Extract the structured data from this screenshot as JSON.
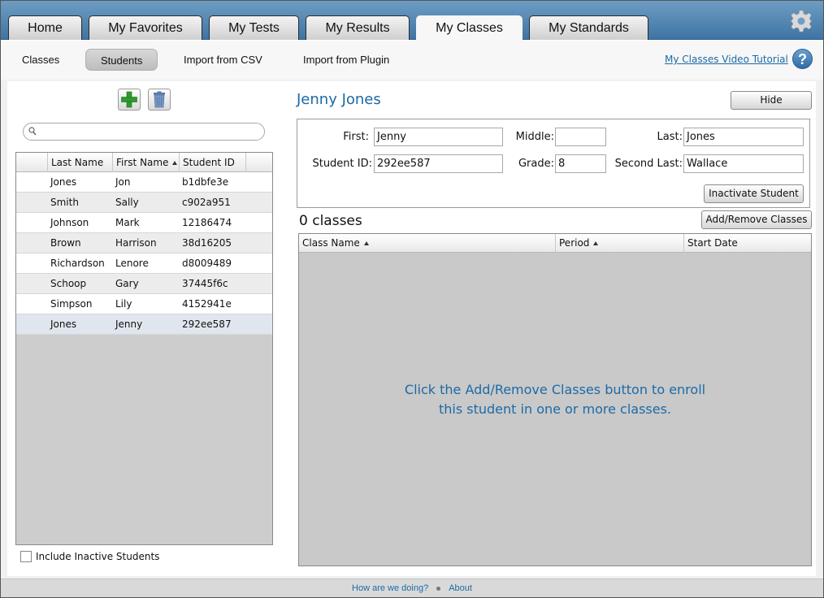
{
  "tabs": [
    {
      "label": "Home",
      "active": false
    },
    {
      "label": "My Favorites",
      "active": false
    },
    {
      "label": "My Tests",
      "active": false
    },
    {
      "label": "My Results",
      "active": false
    },
    {
      "label": "My Classes",
      "active": true
    },
    {
      "label": "My Standards",
      "active": false
    }
  ],
  "subnav": {
    "items": [
      {
        "label": "Classes",
        "active": false
      },
      {
        "label": "Students",
        "active": true
      },
      {
        "label": "Import from CSV",
        "active": false
      },
      {
        "label": "Import from Plugin",
        "active": false
      }
    ],
    "tutorial_link": "My Classes Video Tutorial",
    "help_label": "?"
  },
  "student_list": {
    "search_placeholder": "",
    "columns": [
      "Last Name",
      "First Name",
      "Student ID"
    ],
    "rows": [
      {
        "last": "Jones",
        "first": "Jon",
        "id": "b1dbfe3e"
      },
      {
        "last": "Smith",
        "first": "Sally",
        "id": "c902a951"
      },
      {
        "last": "Johnson",
        "first": "Mark",
        "id": "12186474"
      },
      {
        "last": "Brown",
        "first": "Harrison",
        "id": "38d16205"
      },
      {
        "last": "Richardson",
        "first": "Lenore",
        "id": "d8009489"
      },
      {
        "last": "Schoop",
        "first": "Gary",
        "id": "37445f6c"
      },
      {
        "last": "Simpson",
        "first": "Lily",
        "id": "4152941e"
      },
      {
        "last": "Jones",
        "first": "Jenny",
        "id": "292ee587"
      }
    ],
    "selected_index": 7,
    "include_inactive_label": "Include Inactive Students",
    "include_inactive_checked": false
  },
  "student_detail": {
    "name": "Jenny Jones",
    "hide_label": "Hide",
    "fields": {
      "first_label": "First:",
      "first_value": "Jenny",
      "middle_label": "Middle:",
      "middle_value": "",
      "last_label": "Last:",
      "last_value": "Jones",
      "student_id_label": "Student ID:",
      "student_id_value": "292ee587",
      "grade_label": "Grade:",
      "grade_value": "8",
      "second_last_label": "Second Last:",
      "second_last_value": "Wallace"
    },
    "inactivate_label": "Inactivate Student"
  },
  "classes": {
    "count_label": "0 classes",
    "add_remove_label": "Add/Remove Classes",
    "columns": [
      "Class Name",
      "Period",
      "Start Date"
    ],
    "empty_line1": "Click the Add/Remove Classes button to enroll",
    "empty_line2": "this student in one or more classes."
  },
  "footer": {
    "feedback_link": "How are we doing?",
    "about_link": "About"
  },
  "colors": {
    "accent": "#1c6aa6",
    "tabbar": "#4f84b2"
  }
}
